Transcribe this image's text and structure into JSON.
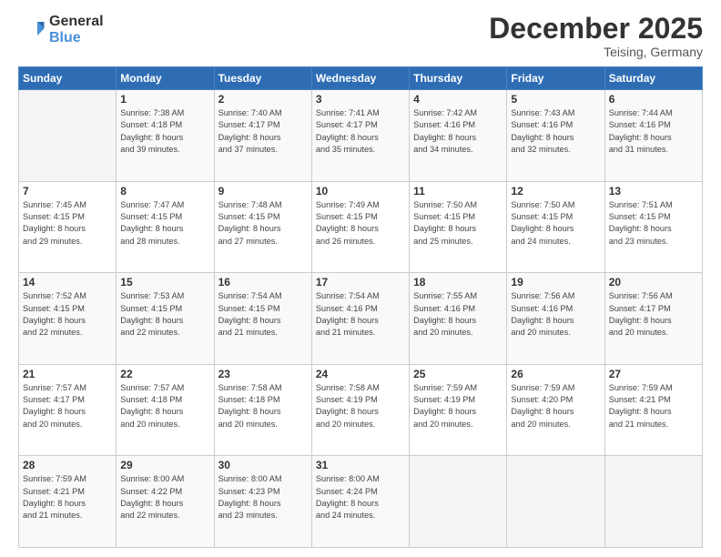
{
  "logo": {
    "general": "General",
    "blue": "Blue"
  },
  "header": {
    "month": "December 2025",
    "location": "Teising, Germany"
  },
  "weekdays": [
    "Sunday",
    "Monday",
    "Tuesday",
    "Wednesday",
    "Thursday",
    "Friday",
    "Saturday"
  ],
  "weeks": [
    [
      {
        "day": "",
        "info": ""
      },
      {
        "day": "1",
        "info": "Sunrise: 7:38 AM\nSunset: 4:18 PM\nDaylight: 8 hours\nand 39 minutes."
      },
      {
        "day": "2",
        "info": "Sunrise: 7:40 AM\nSunset: 4:17 PM\nDaylight: 8 hours\nand 37 minutes."
      },
      {
        "day": "3",
        "info": "Sunrise: 7:41 AM\nSunset: 4:17 PM\nDaylight: 8 hours\nand 35 minutes."
      },
      {
        "day": "4",
        "info": "Sunrise: 7:42 AM\nSunset: 4:16 PM\nDaylight: 8 hours\nand 34 minutes."
      },
      {
        "day": "5",
        "info": "Sunrise: 7:43 AM\nSunset: 4:16 PM\nDaylight: 8 hours\nand 32 minutes."
      },
      {
        "day": "6",
        "info": "Sunrise: 7:44 AM\nSunset: 4:16 PM\nDaylight: 8 hours\nand 31 minutes."
      }
    ],
    [
      {
        "day": "7",
        "info": "Sunrise: 7:45 AM\nSunset: 4:15 PM\nDaylight: 8 hours\nand 29 minutes."
      },
      {
        "day": "8",
        "info": "Sunrise: 7:47 AM\nSunset: 4:15 PM\nDaylight: 8 hours\nand 28 minutes."
      },
      {
        "day": "9",
        "info": "Sunrise: 7:48 AM\nSunset: 4:15 PM\nDaylight: 8 hours\nand 27 minutes."
      },
      {
        "day": "10",
        "info": "Sunrise: 7:49 AM\nSunset: 4:15 PM\nDaylight: 8 hours\nand 26 minutes."
      },
      {
        "day": "11",
        "info": "Sunrise: 7:50 AM\nSunset: 4:15 PM\nDaylight: 8 hours\nand 25 minutes."
      },
      {
        "day": "12",
        "info": "Sunrise: 7:50 AM\nSunset: 4:15 PM\nDaylight: 8 hours\nand 24 minutes."
      },
      {
        "day": "13",
        "info": "Sunrise: 7:51 AM\nSunset: 4:15 PM\nDaylight: 8 hours\nand 23 minutes."
      }
    ],
    [
      {
        "day": "14",
        "info": "Sunrise: 7:52 AM\nSunset: 4:15 PM\nDaylight: 8 hours\nand 22 minutes."
      },
      {
        "day": "15",
        "info": "Sunrise: 7:53 AM\nSunset: 4:15 PM\nDaylight: 8 hours\nand 22 minutes."
      },
      {
        "day": "16",
        "info": "Sunrise: 7:54 AM\nSunset: 4:15 PM\nDaylight: 8 hours\nand 21 minutes."
      },
      {
        "day": "17",
        "info": "Sunrise: 7:54 AM\nSunset: 4:16 PM\nDaylight: 8 hours\nand 21 minutes."
      },
      {
        "day": "18",
        "info": "Sunrise: 7:55 AM\nSunset: 4:16 PM\nDaylight: 8 hours\nand 20 minutes."
      },
      {
        "day": "19",
        "info": "Sunrise: 7:56 AM\nSunset: 4:16 PM\nDaylight: 8 hours\nand 20 minutes."
      },
      {
        "day": "20",
        "info": "Sunrise: 7:56 AM\nSunset: 4:17 PM\nDaylight: 8 hours\nand 20 minutes."
      }
    ],
    [
      {
        "day": "21",
        "info": "Sunrise: 7:57 AM\nSunset: 4:17 PM\nDaylight: 8 hours\nand 20 minutes."
      },
      {
        "day": "22",
        "info": "Sunrise: 7:57 AM\nSunset: 4:18 PM\nDaylight: 8 hours\nand 20 minutes."
      },
      {
        "day": "23",
        "info": "Sunrise: 7:58 AM\nSunset: 4:18 PM\nDaylight: 8 hours\nand 20 minutes."
      },
      {
        "day": "24",
        "info": "Sunrise: 7:58 AM\nSunset: 4:19 PM\nDaylight: 8 hours\nand 20 minutes."
      },
      {
        "day": "25",
        "info": "Sunrise: 7:59 AM\nSunset: 4:19 PM\nDaylight: 8 hours\nand 20 minutes."
      },
      {
        "day": "26",
        "info": "Sunrise: 7:59 AM\nSunset: 4:20 PM\nDaylight: 8 hours\nand 20 minutes."
      },
      {
        "day": "27",
        "info": "Sunrise: 7:59 AM\nSunset: 4:21 PM\nDaylight: 8 hours\nand 21 minutes."
      }
    ],
    [
      {
        "day": "28",
        "info": "Sunrise: 7:59 AM\nSunset: 4:21 PM\nDaylight: 8 hours\nand 21 minutes."
      },
      {
        "day": "29",
        "info": "Sunrise: 8:00 AM\nSunset: 4:22 PM\nDaylight: 8 hours\nand 22 minutes."
      },
      {
        "day": "30",
        "info": "Sunrise: 8:00 AM\nSunset: 4:23 PM\nDaylight: 8 hours\nand 23 minutes."
      },
      {
        "day": "31",
        "info": "Sunrise: 8:00 AM\nSunset: 4:24 PM\nDaylight: 8 hours\nand 24 minutes."
      },
      {
        "day": "",
        "info": ""
      },
      {
        "day": "",
        "info": ""
      },
      {
        "day": "",
        "info": ""
      }
    ]
  ]
}
